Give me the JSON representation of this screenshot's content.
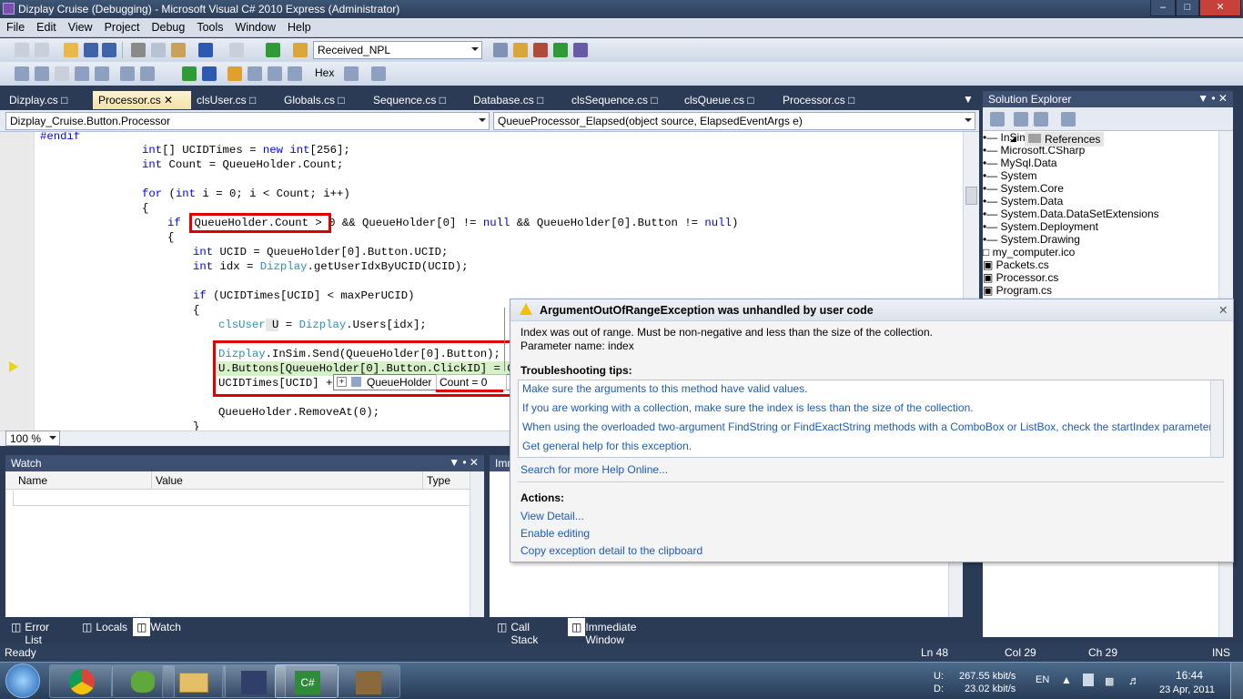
{
  "window": {
    "title": "Dizplay Cruise (Debugging) - Microsoft Visual C# 2010 Express (Administrator)"
  },
  "menu": [
    "File",
    "Edit",
    "View",
    "Project",
    "Debug",
    "Tools",
    "Window",
    "Help"
  ],
  "toolbar": {
    "config_combo": "Received_NPL",
    "hex_label": "Hex"
  },
  "tabs": [
    {
      "label": "Dizplay.cs",
      "locked": true
    },
    {
      "label": "Processor.cs",
      "active": true
    },
    {
      "label": "clsUser.cs",
      "locked": true
    },
    {
      "label": "Globals.cs",
      "locked": true
    },
    {
      "label": "Sequence.cs",
      "locked": true
    },
    {
      "label": "Database.cs",
      "locked": true
    },
    {
      "label": "clsSequence.cs",
      "locked": true
    },
    {
      "label": "clsQueue.cs",
      "locked": true
    },
    {
      "label": "Processor.cs",
      "locked": true
    }
  ],
  "nav": {
    "type_combo": "Dizplay_Cruise.Button.Processor",
    "member_combo": "QueueProcessor_Elapsed(object source, ElapsedEventArgs e)"
  },
  "code": {
    "line_endif": "#endif",
    "line1_type": "int",
    "line1_rest": "[] UCIDTimes = ",
    "line1_new": "new",
    "line1_int": "int",
    "line1_end": "[256];",
    "line2_int": "int",
    "line2_rest": " Count = QueueHolder.Count;",
    "line3_for": "for",
    "line3_int": "int",
    "line3_rest_a": " (",
    "line3_rest_b": " i = 0; i < Count; i++)",
    "brace_open": "{",
    "line4_if": "if",
    "line4_box": "QueueHolder.Count > 0",
    "line4_rest": " && QueueHolder[0] != ",
    "line4_null1": "null",
    "line4_rest2": " && QueueHolder[0].Button != ",
    "line4_null2": "null",
    "line4_end": ")",
    "line5_int": "int",
    "line5_rest": " UCID = QueueHolder[0].Button.UCID;",
    "line6_int": "int",
    "line6_rest_a": " idx = ",
    "line6_dizplay": "Dizplay",
    "line6_rest_b": ".getUserIdxByUCID(UCID);",
    "line7_if": "if",
    "line7_rest": " (UCIDTimes[UCID] < maxPerUCID)",
    "line8_cls": "clsUser",
    "line8_u": " U",
    "line8_rest_a": " = ",
    "line8_dizplay": "Dizplay",
    "line8_rest_b": ".Users[idx];",
    "line9_dizplay": "Dizplay",
    "line9_rest": ".InSim.Send(QueueHolder[0].Button);",
    "line10": "U.Buttons[QueueHolder[0].Button.ClickID] = Cop",
    "line11": "UCIDTimes[UCID] +=",
    "line12": "QueueHolder.RemoveAt(0);",
    "brace_close": "}"
  },
  "datatip": {
    "name": "QueueHolder",
    "value": "Count = 0"
  },
  "zoom": "100 %",
  "watch": {
    "title": "Watch",
    "columns": [
      "Name",
      "Value",
      "Type"
    ]
  },
  "immediate_title_partial": "Imm",
  "bottom_tabs_left": [
    "Error List",
    "Locals",
    "Watch"
  ],
  "bottom_tabs_right": [
    "Call Stack",
    "Immediate Window"
  ],
  "solution_explorer": {
    "title": "Solution Explorer",
    "references_label": "References",
    "refs": [
      "InSimDotNet",
      "Microsoft.CSharp",
      "MySql.Data",
      "System",
      "System.Core",
      "System.Data",
      "System.Data.DataSetExtensions",
      "System.Deployment",
      "System.Drawing"
    ],
    "files": [
      "my_computer.ico",
      "Packets.cs",
      "Processor.cs",
      "Program.cs"
    ]
  },
  "exception": {
    "title": "ArgumentOutOfRangeException was unhandled by user code",
    "message1": "Index was out of range. Must be non-negative and less than the size of the collection.",
    "message2": "Parameter name: index",
    "tips_title": "Troubleshooting tips:",
    "tips": [
      "Make sure the arguments to this method have valid values.",
      "If you are working with a collection, make sure the index is less than the size of the collection.",
      "When using the overloaded two-argument FindString or FindExactString methods with a ComboBox or ListBox, check the startIndex parameter.",
      "Get general help for this exception."
    ],
    "search_link": "Search for more Help Online...",
    "actions_title": "Actions:",
    "actions": [
      "View Detail...",
      "Enable editing",
      "Copy exception detail to the clipboard"
    ]
  },
  "status": {
    "left": "Ready",
    "ln": "Ln 48",
    "col": "Col 29",
    "ch": "Ch 29",
    "mode": "INS"
  },
  "tray": {
    "up_label": "U:",
    "down_label": "D:",
    "up": "267.55 kbit/s",
    "down": "23.02 kbit/s",
    "lang": "EN",
    "time": "16:44",
    "date": "23 Apr, 2011"
  },
  "colors": {
    "accent": "#e10000",
    "link": "#1c5bb8",
    "keyword": "#0000ff",
    "type": "#2b91af"
  }
}
